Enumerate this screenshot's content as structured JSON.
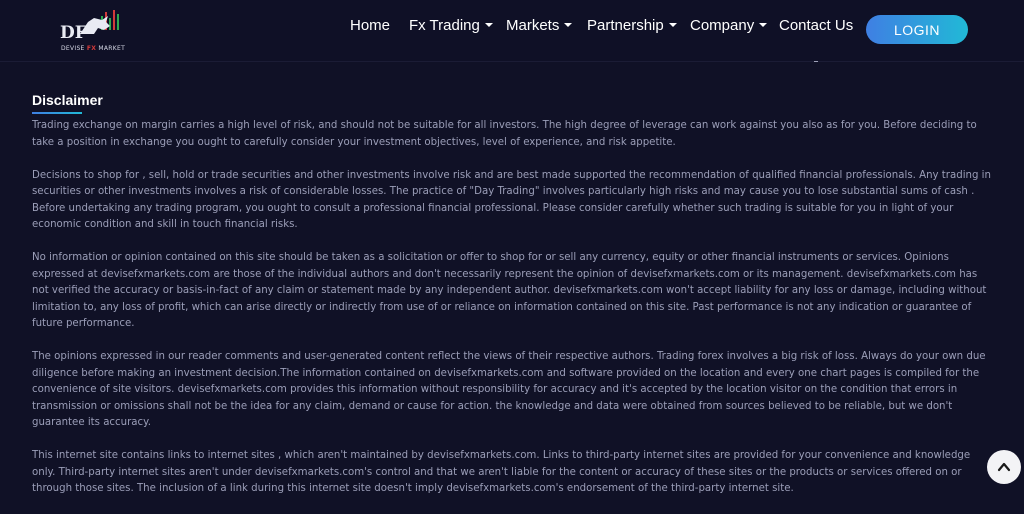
{
  "brand": {
    "logo_letters": "DF",
    "tagline_left": "DEVISE ",
    "tagline_fx": "FX",
    "tagline_right": " MARKET"
  },
  "nav": {
    "home": "Home",
    "fx_trading": "Fx Trading",
    "markets": "Markets",
    "partnership": "Partnership",
    "company": "Company",
    "contact": "Contact Us",
    "login": "LOGIN"
  },
  "disclaimer": {
    "title": "Disclaimer",
    "paragraphs": [
      "Trading exchange on margin carries a high level of risk, and should not be suitable for all investors. The high degree of leverage can work against you also as for you. Before deciding to take a position in exchange you ought to carefully consider your investment objectives, level of experience, and risk appetite.",
      "Decisions to shop for , sell, hold or trade securities and other investments involve risk and are best made supported the recommendation of qualified financial professionals. Any trading in securities or other investments involves a risk of considerable losses. The practice of \"Day Trading\" involves particularly high risks and may cause you to lose substantial sums of cash . Before undertaking any trading program, you ought to consult a professional financial professional. Please consider carefully whether such trading is suitable for you in light of your economic condition and skill in touch financial risks.",
      "No information or opinion contained on this site should be taken as a solicitation or offer to shop for or sell any currency, equity or other financial instruments or services. Opinions expressed at devisefxmarkets.com are those of the individual authors and don't necessarily represent the opinion of devisefxmarkets.com or its management. devisefxmarkets.com has not verified the accuracy or basis-in-fact of any claim or statement made by any independent author. devisefxmarkets.com won't accept liability for any loss or damage, including without limitation to, any loss of profit, which can arise directly or indirectly from use of or reliance on information contained on this site. Past performance is not any indication or guarantee of future performance.",
      "The opinions expressed in our reader comments and user-generated content reflect the views of their respective authors. Trading forex involves a big risk of loss. Always do your own due diligence before making an investment decision.The information contained on devisefxmarkets.com and software provided on the location and every one chart pages is compiled for the convenience of site visitors. devisefxmarkets.com provides this information without responsibility for accuracy and it's accepted by the location visitor on the condition that errors in transmission or omissions shall not be the idea for any claim, demand or cause for action. the knowledge and data were obtained from sources believed to be reliable, but we don't guarantee its accuracy.",
      "This internet site contains links to internet sites , which aren't maintained by devisefxmarkets.com. Links to third-party internet sites are provided for your convenience and knowledge only. Third-party internet sites aren't under devisefxmarkets.com's control and that we aren't liable for the content or accuracy of these sites or the products or services offered on or through those sites. The inclusion of a link during this internet site doesn't imply devisefxmarkets.com's endorsement of the third-party internet site."
    ]
  },
  "colors": {
    "background": "#101126",
    "accent_start": "#3f7fe3",
    "accent_end": "#21b9d6",
    "body_text": "#9b9eb8",
    "logo_red": "#d33a3a"
  },
  "icons": {
    "scroll_top": "chevron-up-icon"
  }
}
